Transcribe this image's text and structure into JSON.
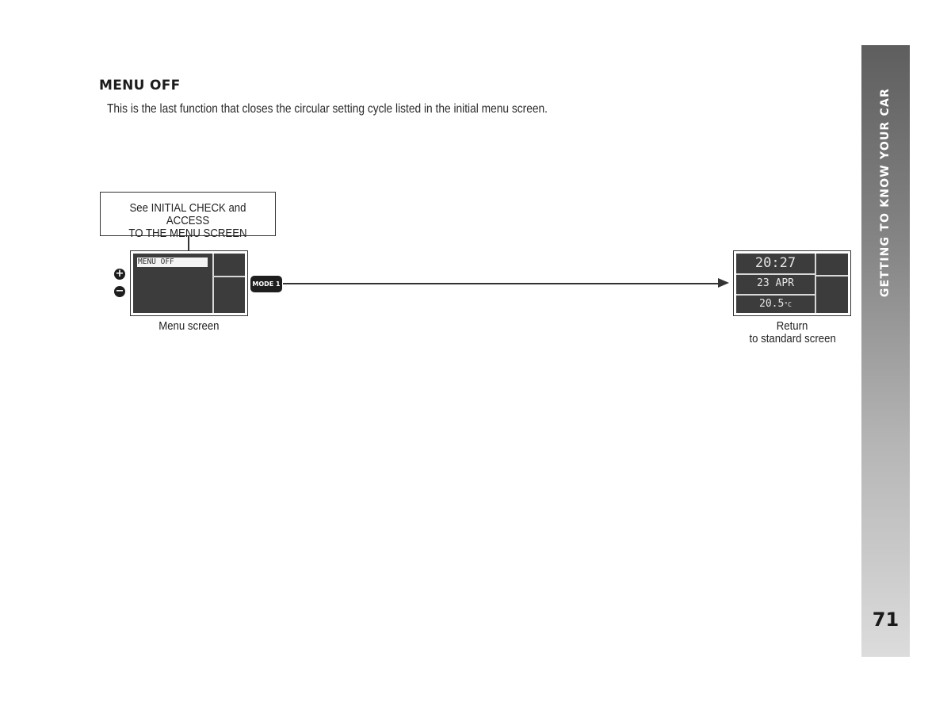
{
  "section": {
    "heading": "MENU OFF",
    "intro": "This is the last function that closes the circular setting cycle listed in the initial menu screen."
  },
  "diagram": {
    "callout": {
      "line1": "See INITIAL CHECK and ACCESS",
      "line2": "TO THE MENU SCREEN"
    },
    "menu_screen": {
      "selected_item": "MENU OFF",
      "caption": "Menu screen"
    },
    "controls": {
      "plus_icon": "+",
      "minus_icon": "−",
      "mode_button": "MODE 1"
    },
    "standard_screen": {
      "time": "20:27",
      "date": "23 APR",
      "temperature": "20.5",
      "temperature_unit": "°C",
      "caption_line1": "Return",
      "caption_line2": "to standard screen"
    }
  },
  "side_tab": {
    "title": "GETTING TO KNOW YOUR CAR",
    "page_number": "71"
  }
}
